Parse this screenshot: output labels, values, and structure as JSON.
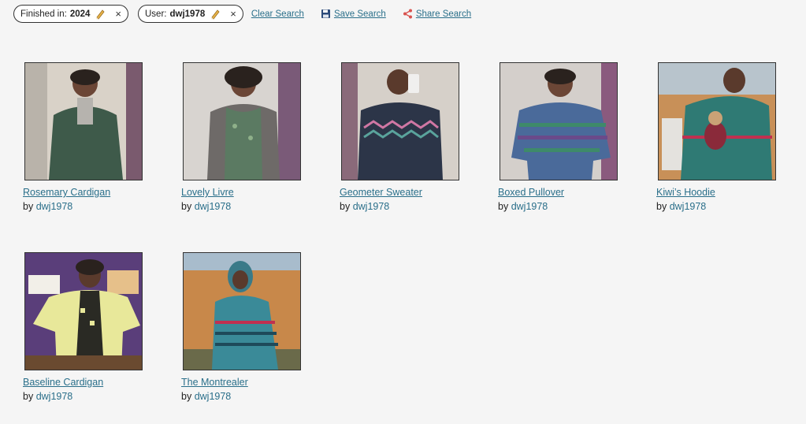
{
  "filters": {
    "chips": [
      {
        "label": "Finished in:",
        "value": "2024",
        "close": "×"
      },
      {
        "label": "User:",
        "value": "dwj1978",
        "close": "×"
      }
    ],
    "actions": {
      "clear": "Clear Search",
      "save": "Save Search",
      "share": "Share Search"
    }
  },
  "icons": {
    "pencil": "pencil-icon",
    "save": "floppy-disk-icon",
    "share": "share-icon"
  },
  "colors": {
    "link": "#2a6f8a",
    "background": "#f5f5f5"
  },
  "projects": [
    {
      "title": "Rosemary Cardigan",
      "by": "by",
      "user": "dwj1978",
      "sweater": "#3e5a4a"
    },
    {
      "title": "Lovely Livre",
      "by": "by",
      "user": "dwj1978",
      "sweater": "#5b7a62"
    },
    {
      "title": "Geometer Sweater",
      "by": "by",
      "user": "dwj1978",
      "sweater": "#2c3548"
    },
    {
      "title": "Boxed Pullover",
      "by": "by",
      "user": "dwj1978",
      "sweater": "#4a6a9a"
    },
    {
      "title": "Kiwi’s Hoodie",
      "by": "by",
      "user": "dwj1978",
      "sweater": "#2f7a74"
    },
    {
      "title": "Baseline Cardigan",
      "by": "by",
      "user": "dwj1978",
      "sweater": "#e8e89a"
    },
    {
      "title": "The Montrealer",
      "by": "by",
      "user": "dwj1978",
      "sweater": "#3a8a98"
    }
  ]
}
